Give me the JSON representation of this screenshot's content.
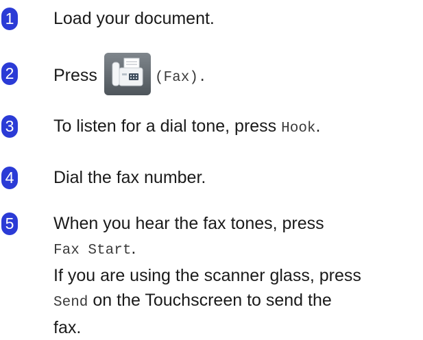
{
  "steps": [
    {
      "num": "1",
      "text": "Load your document."
    },
    {
      "num": "2",
      "press": "Press",
      "button_paren": "(Fax)."
    },
    {
      "num": "3",
      "text": "To listen for a dial tone, press",
      "code": "Hook",
      "end": "."
    },
    {
      "num": "4",
      "text": "Dial the fax number."
    },
    {
      "num": "5",
      "line1": "When you hear the fax tones, press",
      "code1": "Fax Start",
      "end1": ".",
      "line2": "If you are using the scanner glass, press",
      "code2": "Send",
      "line3": "on the Touchscreen to send the",
      "line4": "fax."
    }
  ],
  "fax_icon": "fax-machine-icon"
}
